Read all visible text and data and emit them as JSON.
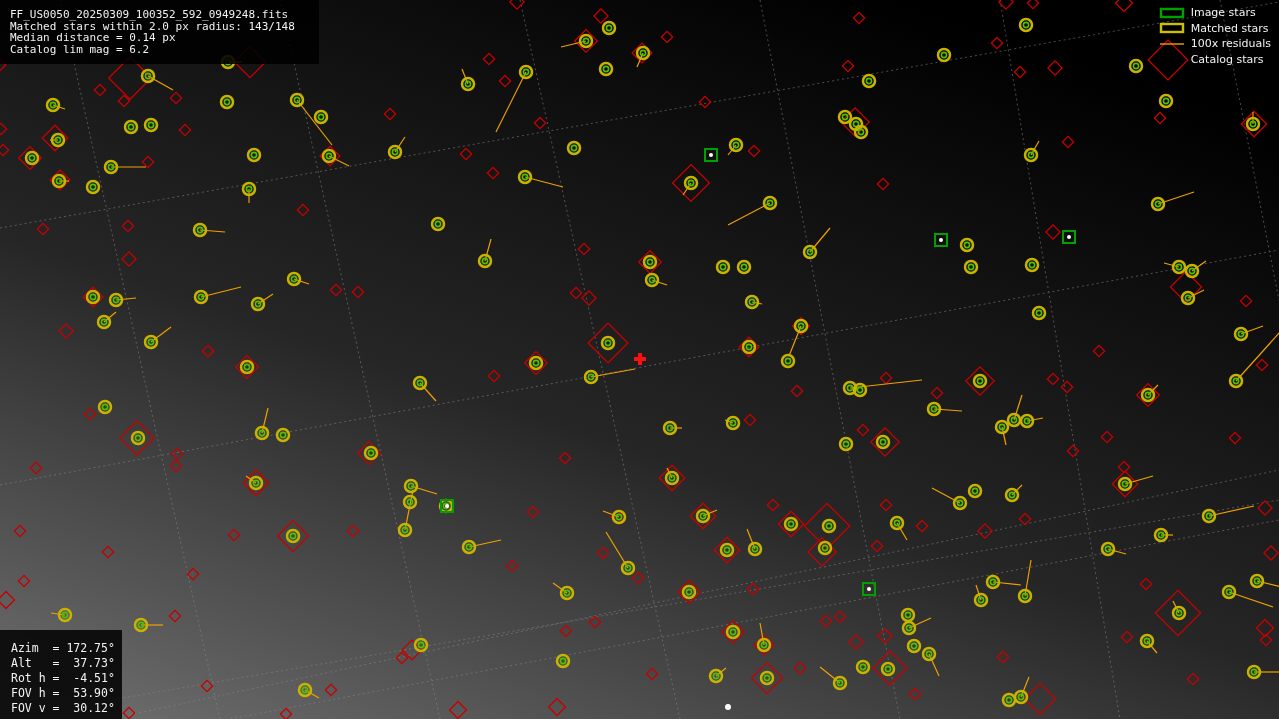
{
  "header": {
    "lines": [
      "FF_US0050_20250309_100352_592_0949248.fits",
      "Matched stars within 2.0 px radius: 143/148",
      "Median distance = 0.14 px",
      "Catalog lim mag = 6.2"
    ]
  },
  "legend": [
    {
      "kind": "image",
      "label": "Image stars"
    },
    {
      "kind": "matched",
      "label": "Matched stars"
    },
    {
      "kind": "residual",
      "label": "100x residuals"
    },
    {
      "kind": "catalog",
      "label": "Catalog stars"
    }
  ],
  "pointing": {
    "lines": [
      "Azim  = 172.75°",
      "Alt   =  37.73°",
      "Rot h =  -4.51°",
      "FOV h =  53.90°",
      "FOV v =  30.12°"
    ]
  }
}
